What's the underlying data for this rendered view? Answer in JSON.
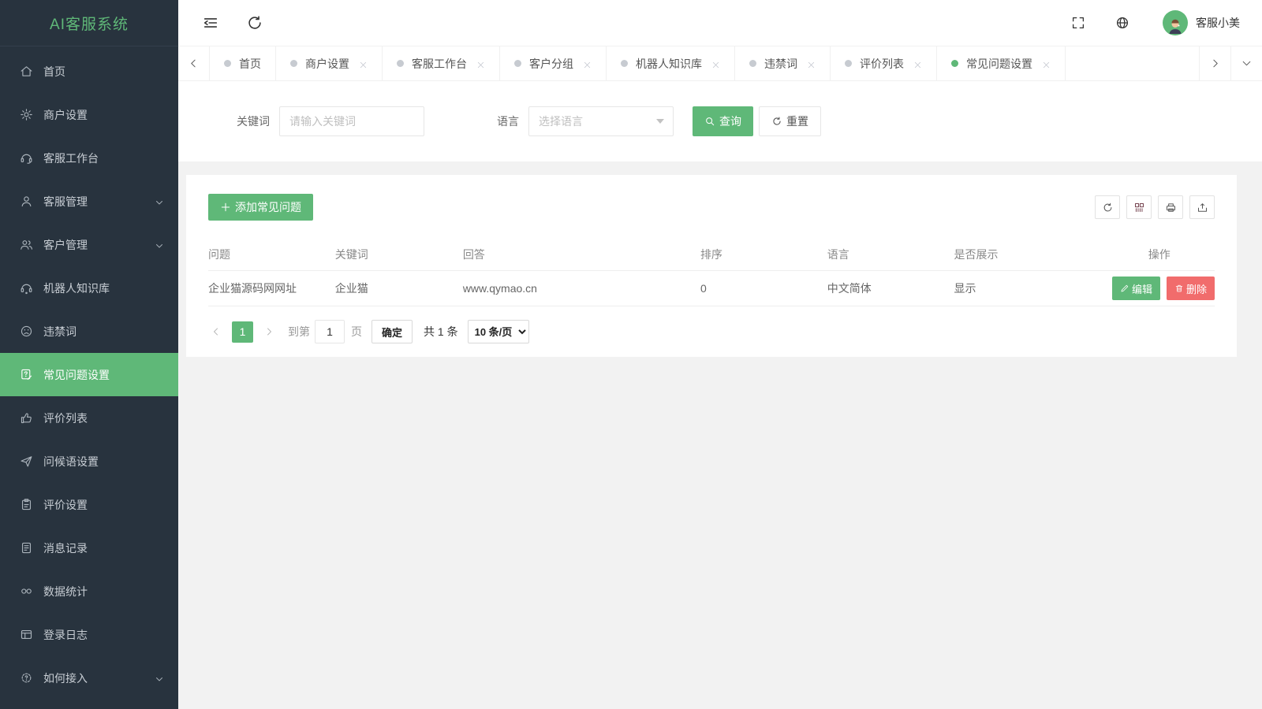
{
  "app": {
    "logo": "AI客服系统",
    "user_name": "客服小美"
  },
  "colors": {
    "green": "#5FB878",
    "red": "#f16c6c",
    "sidebar_bg": "#28333e"
  },
  "sidebar": {
    "items": [
      {
        "label": "首页"
      },
      {
        "label": "商户设置"
      },
      {
        "label": "客服工作台"
      },
      {
        "label": "客服管理"
      },
      {
        "label": "客户管理"
      },
      {
        "label": "机器人知识库"
      },
      {
        "label": "违禁词"
      },
      {
        "label": "常见问题设置"
      },
      {
        "label": "评价列表"
      },
      {
        "label": "问候语设置"
      },
      {
        "label": "评价设置"
      },
      {
        "label": "消息记录"
      },
      {
        "label": "数据统计"
      },
      {
        "label": "登录日志"
      },
      {
        "label": "如何接入"
      }
    ]
  },
  "tabs": {
    "items": [
      {
        "label": "首页"
      },
      {
        "label": "商户设置"
      },
      {
        "label": "客服工作台"
      },
      {
        "label": "客户分组"
      },
      {
        "label": "机器人知识库"
      },
      {
        "label": "违禁词"
      },
      {
        "label": "评价列表"
      },
      {
        "label": "常见问题设置"
      }
    ]
  },
  "search": {
    "keyword_label": "关键词",
    "keyword_placeholder": "请输入关键词",
    "language_label": "语言",
    "language_placeholder": "选择语言",
    "query_button": "查询",
    "reset_button": "重置"
  },
  "toolbar": {
    "add_label": "添加常见问题"
  },
  "table": {
    "columns": [
      "问题",
      "关键词",
      "回答",
      "排序",
      "语言",
      "是否展示",
      "操作"
    ],
    "row": {
      "question": "企业猫源码网网址",
      "keyword": "企业猫",
      "answer": "www.qymao.cn",
      "sort": "0",
      "language": "中文简体",
      "display": "显示"
    },
    "actions": {
      "edit": "编辑",
      "delete": "删除"
    }
  },
  "pagination": {
    "current_page": "1",
    "goto_label": "到第",
    "page_input_value": "1",
    "page_unit": "页",
    "confirm_label": "确定",
    "total_label": "共 1 条",
    "per_page_label": "10 条/页"
  }
}
